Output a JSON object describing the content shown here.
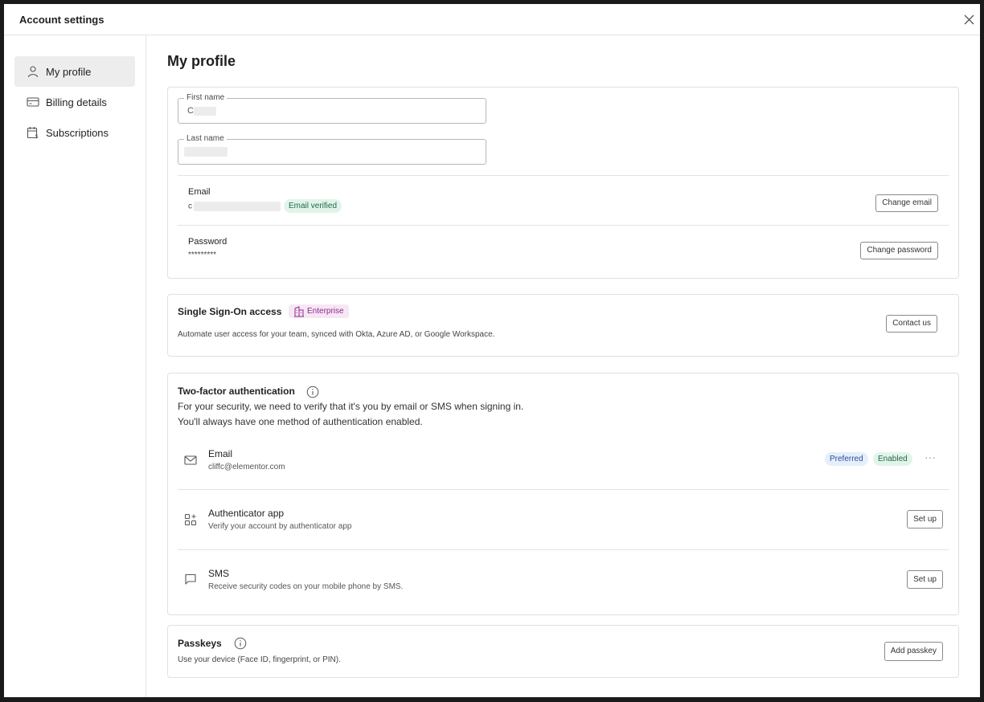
{
  "window": {
    "title": "Account settings"
  },
  "sidebar": {
    "items": [
      {
        "label": "My profile",
        "icon": "user-icon",
        "active": true
      },
      {
        "label": "Billing details",
        "icon": "credit-card-icon",
        "active": false
      },
      {
        "label": "Subscriptions",
        "icon": "calendar-dollar-icon",
        "active": false
      }
    ]
  },
  "profile": {
    "title": "My profile",
    "first_name": {
      "label": "First name",
      "value": "C"
    },
    "last_name": {
      "label": "Last name",
      "value": ""
    },
    "email": {
      "label": "Email",
      "value": "c",
      "badge": "Email verified",
      "button": "Change email"
    },
    "password": {
      "label": "Password",
      "value": "*********",
      "button": "Change password"
    }
  },
  "sso": {
    "title": "Single Sign-On access",
    "badge": "Enterprise",
    "description": "Automate user access for your team, synced with Okta, Azure AD, or Google Workspace.",
    "button": "Contact us"
  },
  "two_factor": {
    "title": "Two-factor authentication",
    "desc_line1": "For your security, we need to verify that it's you by email or SMS when signing in.",
    "desc_line2": "You'll always have one method of authentication enabled.",
    "methods": {
      "email": {
        "title": "Email",
        "subtitle": "cliffc@elementor.com",
        "badge_preferred": "Preferred",
        "badge_enabled": "Enabled",
        "more": "···"
      },
      "app": {
        "title": "Authenticator app",
        "subtitle": "Verify your account by authenticator app",
        "button": "Set up"
      },
      "sms": {
        "title": "SMS",
        "subtitle": "Receive security codes on your mobile phone by SMS.",
        "button": "Set up"
      }
    }
  },
  "passkeys": {
    "title": "Passkeys",
    "description": "Use your device (Face ID, fingerprint, or PIN).",
    "button": "Add passkey"
  },
  "colors": {
    "green_badge_bg": "#e1f4ea",
    "blue_badge_bg": "#e6eefb",
    "purple_badge_bg": "#f6e7f5",
    "sidebar_active_bg": "#ededed"
  }
}
